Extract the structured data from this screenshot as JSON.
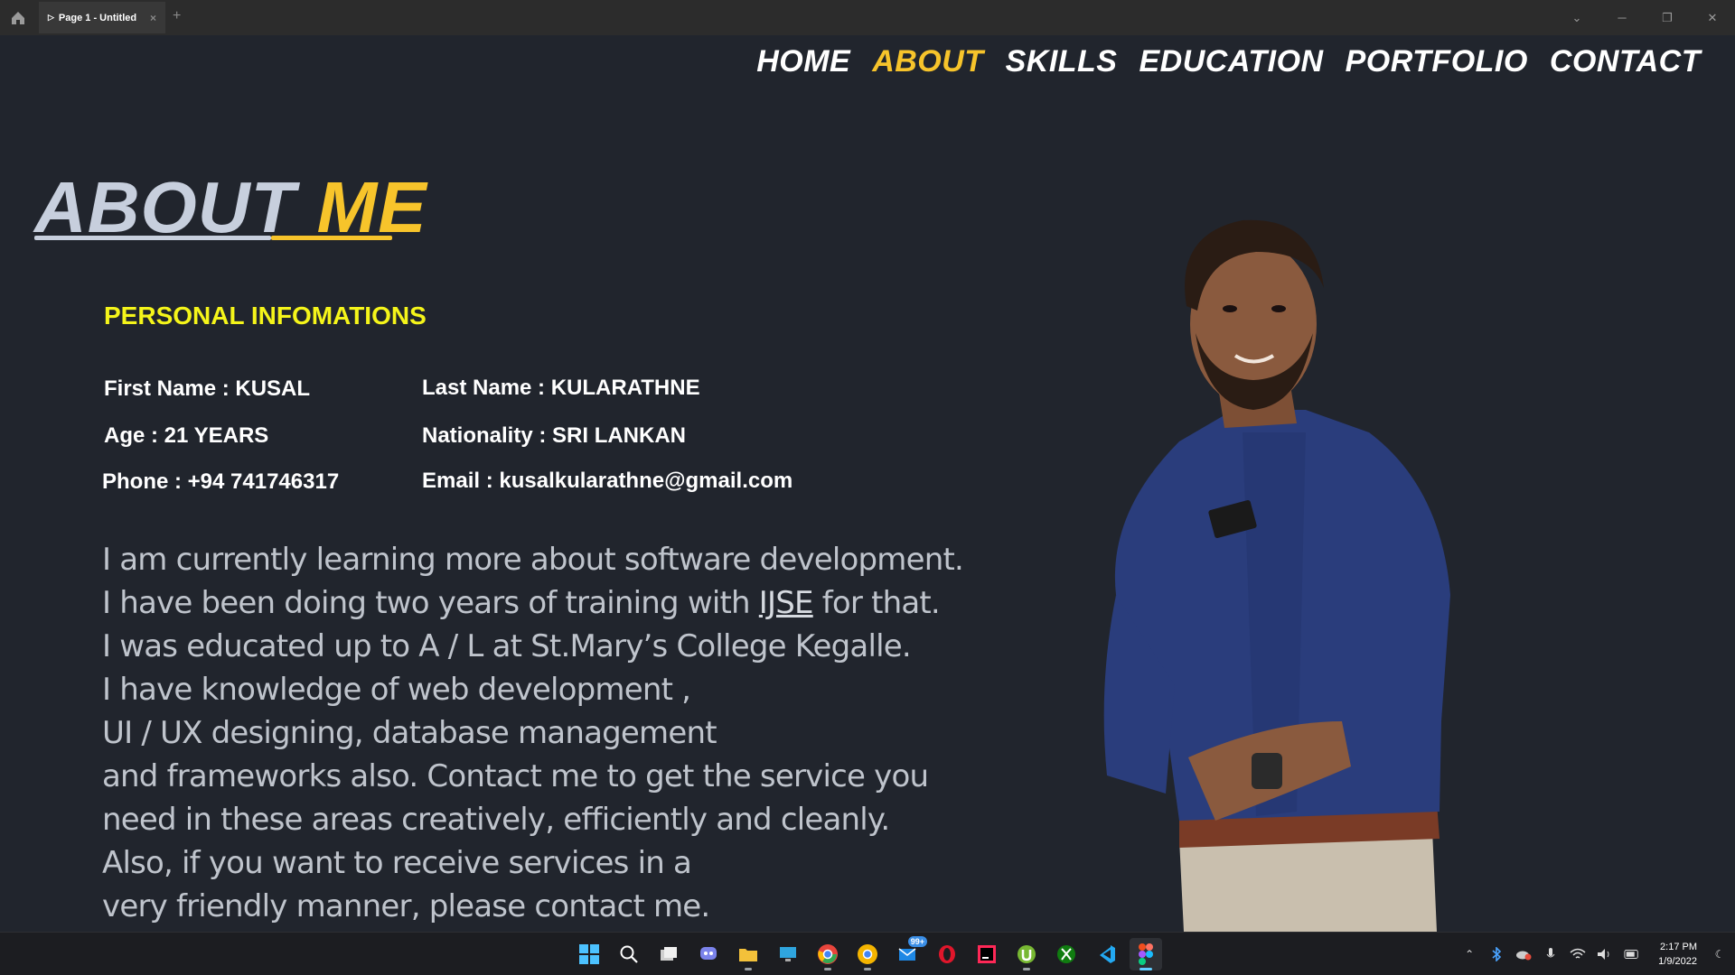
{
  "titlebar": {
    "tab_label": "Page 1 - Untitled",
    "tab_close": "×",
    "tab_add": "+"
  },
  "nav": {
    "items": [
      "HOME",
      "ABOUT",
      "SKILLS",
      "EDUCATION",
      "PORTFOLIO",
      "CONTACT"
    ],
    "active": "ABOUT"
  },
  "about": {
    "title_part1": "ABOUT",
    "title_part2": "ME",
    "section_heading": "PERSONAL INFOMATIONS",
    "first_name": "First Name : KUSAL",
    "last_name": "Last Name : KULARATHNE",
    "age": "Age : 21 YEARS",
    "nationality": "Nationality : SRI LANKAN",
    "phone": "Phone : +94 741746317",
    "email": "Email : kusalkularathne@gmail.com",
    "bio": {
      "line1": "I am currently learning more about software development.",
      "line2_pre": "I have been doing two years of training with ",
      "line2_link": "IJSE",
      "line2_post": " for that.",
      "line3": "I was educated up to A / L at St.Mary’s College Kegalle.",
      "line4": "I  have knowledge of web development ,",
      "line5": "UI / UX designing, database management",
      "line6": "and frameworks also. Contact me to get the service you",
      "line7": "need in these areas creatively, efficiently and cleanly.",
      "line8": "Also, if you want to receive services in a",
      "line9": "very friendly manner, please contact me."
    }
  },
  "taskbar": {
    "icons": [
      "windows-start-icon",
      "search-icon",
      "task-view-icon",
      "teams-chat-icon",
      "file-explorer-icon",
      "remote-desktop-icon",
      "chrome-icon",
      "chrome-canary-icon",
      "mail-icon",
      "opera-icon",
      "intellij-icon",
      "utorrent-icon",
      "xbox-icon",
      "vscode-icon",
      "figma-icon"
    ],
    "mail_badge": "99+",
    "time": "2:17 PM",
    "date": "1/9/2022"
  },
  "colors": {
    "accent_yellow": "#f7c42b",
    "heading_yellow": "#f5f51a",
    "background": "#21252d"
  }
}
